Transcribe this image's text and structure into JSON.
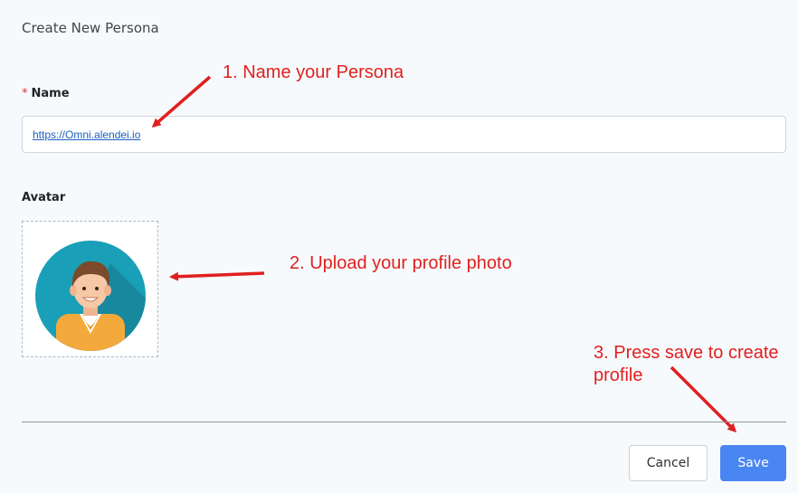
{
  "page": {
    "title": "Create New Persona"
  },
  "form": {
    "name": {
      "required_mark": "*",
      "label": "Name",
      "value": "https://Omni.alendei.io"
    },
    "avatar": {
      "label": "Avatar",
      "image": "default-male-avatar"
    }
  },
  "actions": {
    "cancel_label": "Cancel",
    "save_label": "Save"
  },
  "annotations": {
    "step1": "1. Name your Persona",
    "step2": "2. Upload your profile photo",
    "step3_line1": "3. Press save to create",
    "step3_line2": "profile"
  },
  "colors": {
    "annotation": "#e11f1f",
    "primary": "#4a86f2",
    "required": "#e0323c",
    "link": "#1b5fc1"
  }
}
